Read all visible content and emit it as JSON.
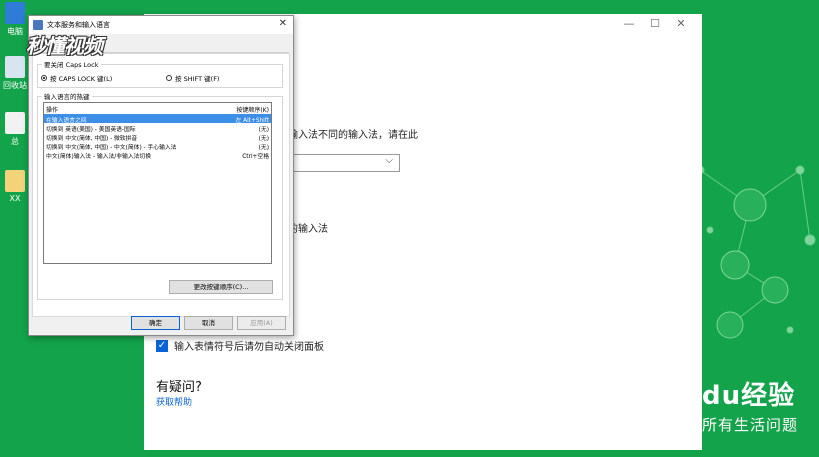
{
  "desktop": {
    "icons": [
      {
        "label": "电脑",
        "color": "#2f7bd8"
      },
      {
        "label": "回收站",
        "color": "#d8e4ef"
      },
      {
        "label": "总",
        "color": "#f2f2f2"
      },
      {
        "label": "XX",
        "color": "#f4d27a"
      }
    ],
    "brand_logo": "du经验",
    "brand_tagline": "所有生活问题"
  },
  "settings_window": {
    "controls": [
      "—",
      "☐",
      "✕"
    ],
    "description": "输入法不同的输入法，请在此",
    "description2": "的输入法",
    "checkbox_label": "输入表情符号后请勿自动关闭面板",
    "checkbox_checked": true,
    "question_heading": "有疑问?",
    "help_link": "获取帮助"
  },
  "dialog": {
    "title": "文本服务和输入语言",
    "close": "✕",
    "watermark": "秒懂视频",
    "caps_group_title": "要关闭 Caps Lock",
    "radio_caps": "按 CAPS LOCK 键(L)",
    "radio_shift": "按 SHIFT 键(F)",
    "selected_radio": "caps",
    "hotkey_group_title": "输入语言的热键",
    "list_headers": {
      "action": "操作",
      "keys": "按键顺序(K)"
    },
    "rows": [
      {
        "action": "在输入语言之间",
        "keys": "左 Alt+Shift",
        "selected": true
      },
      {
        "action": "切换到 英语(美国) - 美国英语-国际",
        "keys": "(无)",
        "selected": false
      },
      {
        "action": "切换到 中文(简体, 中国) - 微软拼音",
        "keys": "(无)",
        "selected": false
      },
      {
        "action": "切换到 中文(简体, 中国) - 中文(简体) - 手心输入法",
        "keys": "(无)",
        "selected": false
      },
      {
        "action": "中文(简体)输入法 - 输入法/非输入法切换",
        "keys": "Ctrl+空格",
        "selected": false
      }
    ],
    "change_button": "更改按键顺序(C)...",
    "ok_button": "确定",
    "cancel_button": "取消",
    "apply_button": "应用(A)"
  }
}
